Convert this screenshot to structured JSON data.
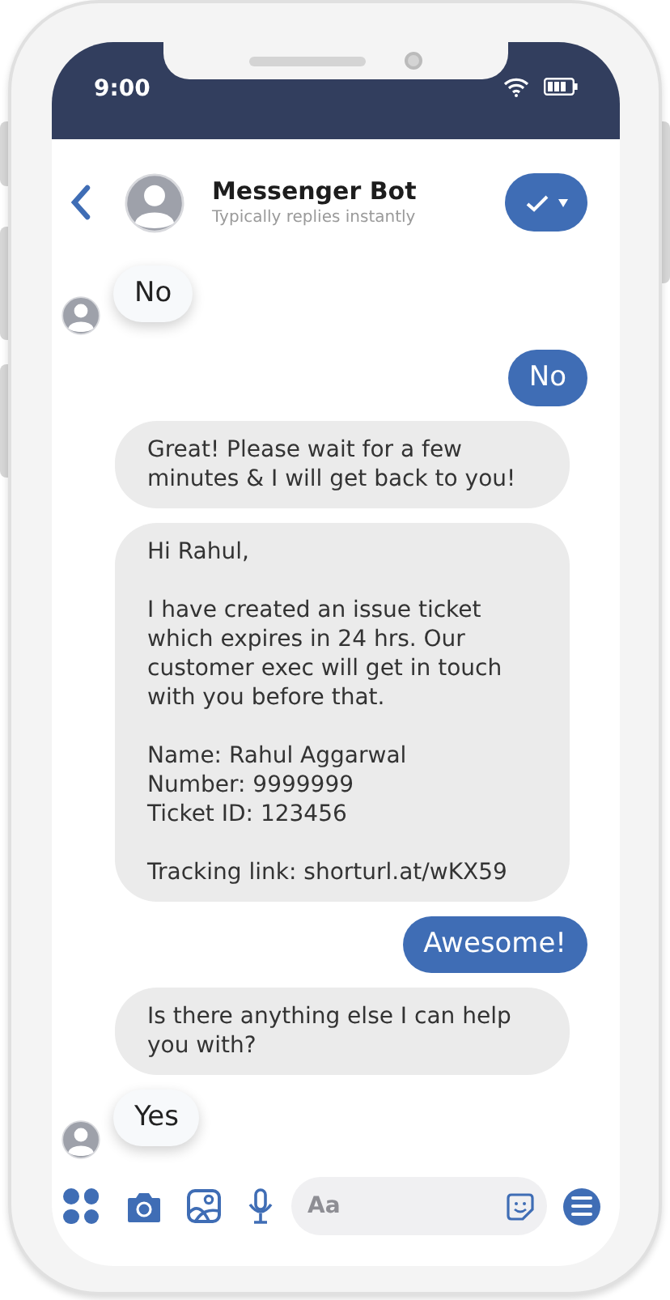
{
  "status_bar": {
    "time": "9:00"
  },
  "header": {
    "title": "Messenger Bot",
    "subtitle": "Typically replies instantly"
  },
  "messages": [
    {
      "kind": "quick_reply",
      "text": "No"
    },
    {
      "kind": "sent",
      "text": "No"
    },
    {
      "kind": "received",
      "text": "Great! Please wait for a few minutes & I will get back to you!"
    },
    {
      "kind": "received",
      "text": "Hi Rahul,\n\nI have created an issue ticket which expires in 24 hrs. Our customer exec will get in touch with you before that.\n\nName: Rahul Aggarwal\nNumber: 9999999\nTicket ID: 123456\n\nTracking link: shorturl.at/wKX59"
    },
    {
      "kind": "sent",
      "text": "Awesome!"
    },
    {
      "kind": "received",
      "text": "Is there anything else I can help you with?"
    },
    {
      "kind": "quick_reply",
      "text": "Yes"
    }
  ],
  "composer": {
    "placeholder": "Aa"
  }
}
